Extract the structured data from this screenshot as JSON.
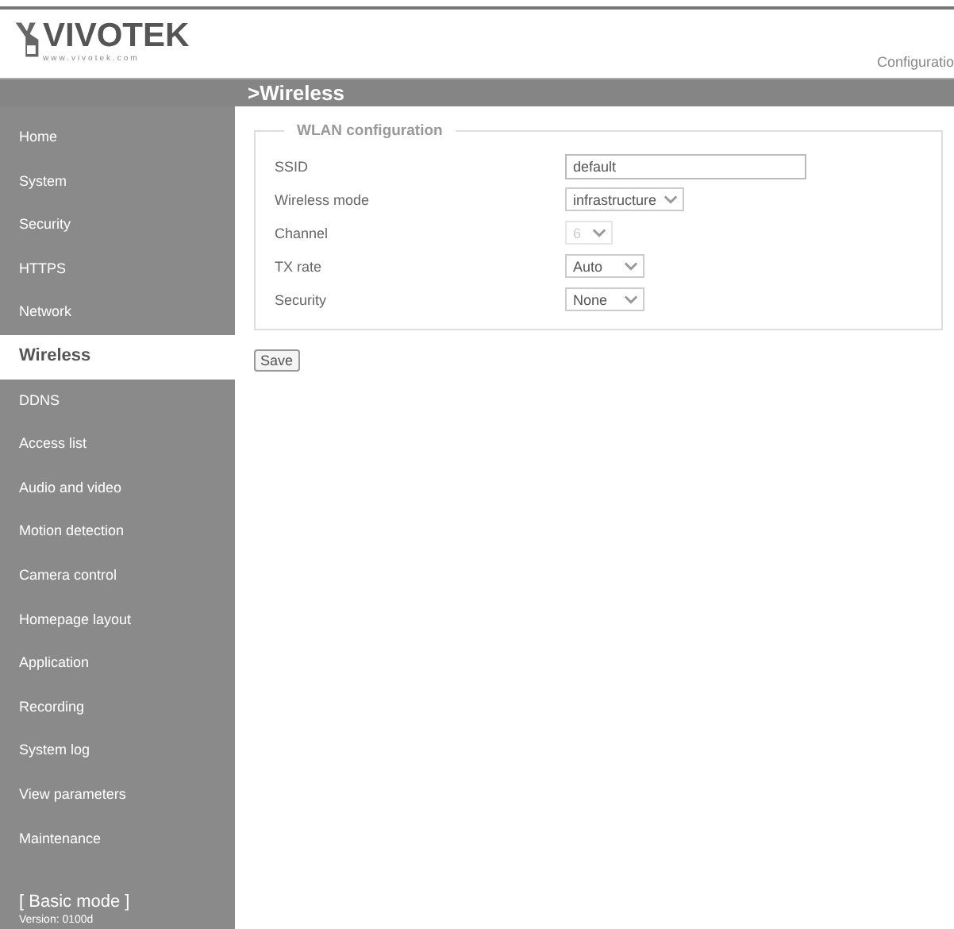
{
  "header": {
    "logo": "VIVOTEK",
    "logo_url": "www.vivotek.com",
    "link": "Configuratio"
  },
  "page_title": ">Wireless",
  "sidebar": {
    "items": [
      {
        "label": "Home",
        "selected": false
      },
      {
        "label": "System",
        "selected": false
      },
      {
        "label": "Security",
        "selected": false
      },
      {
        "label": "HTTPS",
        "selected": false
      },
      {
        "label": "Network",
        "selected": false
      },
      {
        "label": "Wireless",
        "selected": true
      },
      {
        "label": "DDNS",
        "selected": false
      },
      {
        "label": "Access list",
        "selected": false
      },
      {
        "label": "Audio and video",
        "selected": false
      },
      {
        "label": "Motion detection",
        "selected": false
      },
      {
        "label": "Camera control",
        "selected": false
      },
      {
        "label": "Homepage layout",
        "selected": false
      },
      {
        "label": "Application",
        "selected": false
      },
      {
        "label": "Recording",
        "selected": false
      },
      {
        "label": "System log",
        "selected": false
      },
      {
        "label": "View parameters",
        "selected": false
      },
      {
        "label": "Maintenance",
        "selected": false
      }
    ],
    "mode": "[ Basic mode ]",
    "version": "Version: 0100d"
  },
  "fieldset": {
    "legend": "WLAN configuration",
    "rows": [
      {
        "label": "SSID",
        "kind": "text",
        "value": "default"
      },
      {
        "label": "Wireless mode",
        "kind": "select",
        "value": "infrastructure",
        "disabled": false
      },
      {
        "label": "Channel",
        "kind": "select",
        "value": "6",
        "disabled": true
      },
      {
        "label": "TX rate",
        "kind": "select",
        "value": "Auto",
        "disabled": false
      },
      {
        "label": "Security",
        "kind": "select",
        "value": "None",
        "disabled": false
      }
    ]
  },
  "save_button": "Save"
}
